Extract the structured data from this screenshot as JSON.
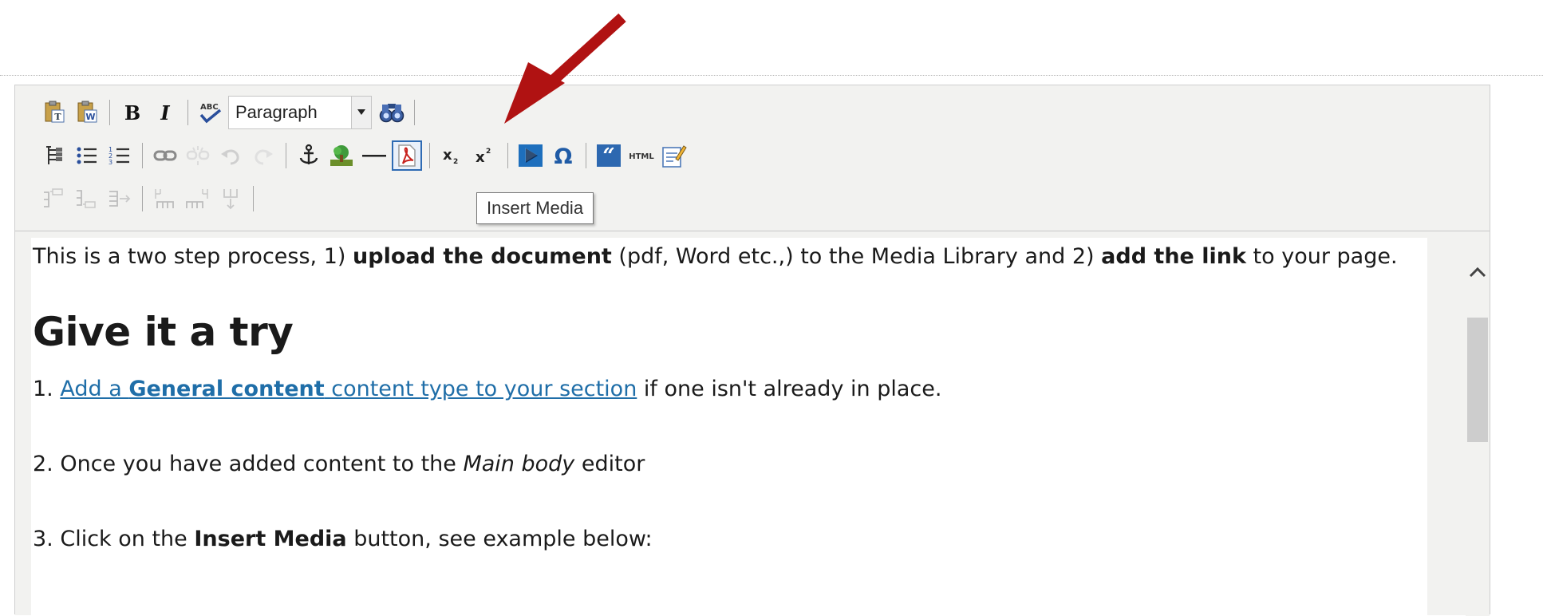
{
  "toolbar": {
    "row1": [
      {
        "icon": "paste-as-text-icon",
        "title": "Paste as text"
      },
      {
        "icon": "paste-from-word-icon",
        "title": "Paste from Word"
      },
      {
        "icon": "bold-icon",
        "title": "Bold",
        "glyph": "B"
      },
      {
        "icon": "italic-icon",
        "title": "Italic",
        "glyph": "I"
      },
      {
        "icon": "spellcheck-icon",
        "title": "Spell check"
      }
    ],
    "format_select": {
      "value": "Paragraph"
    },
    "row2_labels": {
      "html": "HTML"
    },
    "tooltip": "Insert Media",
    "colors": {
      "active_border": "#2f6bb3",
      "arrow": "#b01212",
      "link": "#1f6ea8"
    }
  },
  "content": {
    "intro": {
      "pre": "This is a two step process, 1) ",
      "b1": "upload the document",
      "mid": " (pdf, Word etc.,) to the Media Library and 2) ",
      "b2": "add the link",
      "post": " to your page."
    },
    "heading": "Give it a try",
    "step1": {
      "num": "1. ",
      "link_pre": "Add a ",
      "link_bold": "General content",
      "link_post": " content type to your section",
      "rest": " if one isn't already in place."
    },
    "step2": {
      "pre": "2. Once you have added content to the ",
      "em": "Main body",
      "post": " editor"
    },
    "step3": {
      "pre": "3. Click on the ",
      "b": "Insert Media",
      "post": " button, see example below:"
    }
  }
}
